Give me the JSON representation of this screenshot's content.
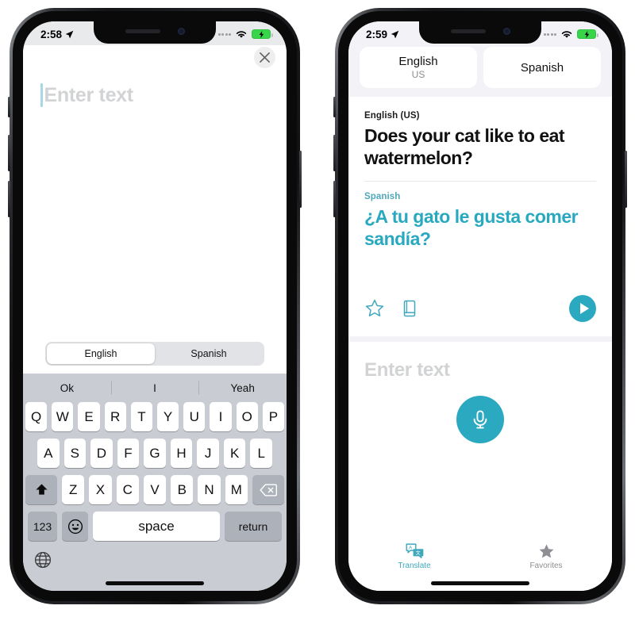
{
  "left_phone": {
    "status_bar": {
      "time": "2:58",
      "location_icon": "location-arrow-icon",
      "cellular_icon": "cellular-dots-icon",
      "wifi_icon": "wifi-icon",
      "battery_icon": "battery-charging-icon"
    },
    "close_button": {
      "icon": "close-x-icon"
    },
    "text_input": {
      "placeholder": "Enter text",
      "value": ""
    },
    "language_segments": [
      {
        "label": "English",
        "active": true
      },
      {
        "label": "Spanish",
        "active": false
      }
    ],
    "keyboard": {
      "suggestions": [
        "Ok",
        "I",
        "Yeah"
      ],
      "row1": [
        "Q",
        "W",
        "E",
        "R",
        "T",
        "Y",
        "U",
        "I",
        "O",
        "P"
      ],
      "row2": [
        "A",
        "S",
        "D",
        "F",
        "G",
        "H",
        "J",
        "K",
        "L"
      ],
      "row3": [
        "Z",
        "X",
        "C",
        "V",
        "B",
        "N",
        "M"
      ],
      "shift_icon": "shift-arrow-icon",
      "backspace_icon": "backspace-icon",
      "numbers_key": "123",
      "emoji_icon": "emoji-smiley-icon",
      "space_key": "space",
      "return_key": "return",
      "globe_icon": "globe-icon"
    }
  },
  "right_phone": {
    "status_bar": {
      "time": "2:59",
      "location_icon": "location-arrow-icon",
      "cellular_icon": "cellular-dots-icon",
      "wifi_icon": "wifi-icon",
      "battery_icon": "battery-charging-icon"
    },
    "language_picker": {
      "source": {
        "name": "English",
        "region": "US"
      },
      "target": {
        "name": "Spanish",
        "region": ""
      }
    },
    "result": {
      "source_label": "English (US)",
      "source_text": "Does your cat like to eat watermelon?",
      "target_label": "Spanish",
      "target_text": "¿A tu gato le gusta comer sandía?",
      "actions": {
        "favorite_icon": "star-outline-icon",
        "dictionary_icon": "dictionary-book-icon",
        "play_icon": "play-triangle-icon"
      }
    },
    "input": {
      "placeholder": "Enter text",
      "mic_icon": "microphone-icon"
    },
    "tabs": [
      {
        "label": "Translate",
        "icon": "translate-icon",
        "active": true
      },
      {
        "label": "Favorites",
        "icon": "star-filled-icon",
        "active": false
      }
    ]
  },
  "colors": {
    "accent_teal": "#2ba9c0",
    "translated_text": "#29a9c0",
    "keyboard_bg": "#c9ccd3",
    "ios_background": "#f2f2f7",
    "battery_green": "#38d44a",
    "placeholder_gray": "#d2d3d5"
  }
}
